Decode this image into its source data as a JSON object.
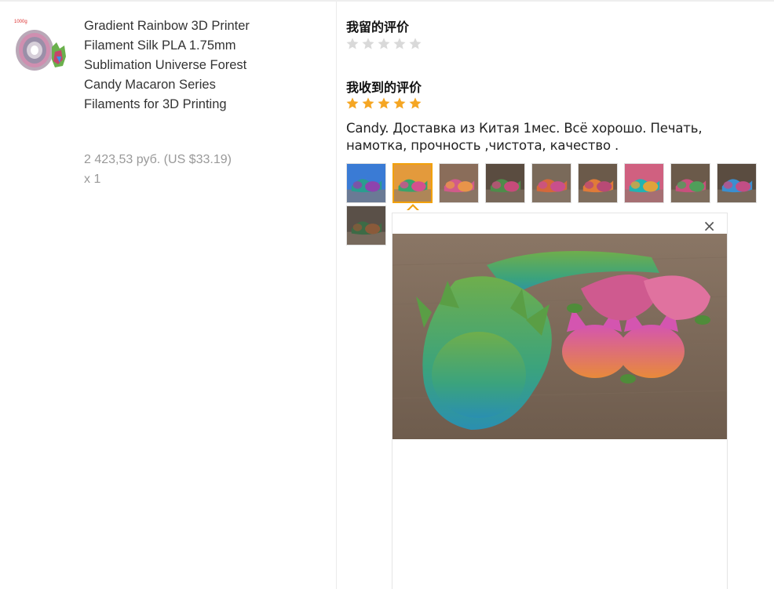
{
  "product": {
    "image_label": "1000g",
    "title": "Gradient Rainbow 3D Printer Filament Silk PLA 1.75mm Sublimation Universe Forest Candy Macaron Series Filaments for 3D Printing",
    "price": "2 423,53 руб. (US $33.19)",
    "quantity": "x 1"
  },
  "my_review": {
    "title": "我留的评价",
    "rating": 0,
    "star_color": "#d9d9d9"
  },
  "received_review": {
    "title": "我收到的评价",
    "rating": 5,
    "star_color": "#f5a623",
    "text": "Candy. Доставка из Китая 1мес. Всё хорошо. Печать, намотка, прочность ,чистота, качество .",
    "photos": [
      {
        "name": "photo-1-axolotl-rainbow",
        "colors": [
          "#2a9d8f",
          "#8e44ad",
          "#3a7bd5"
        ]
      },
      {
        "name": "photo-2-axolotl-green-fox",
        "colors": [
          "#3aa36b",
          "#d4508f",
          "#e39a3c"
        ]
      },
      {
        "name": "photo-3-foxes-pink",
        "colors": [
          "#d05b8a",
          "#e8944a",
          "#8a6d5a"
        ]
      },
      {
        "name": "photo-4-dragon-green",
        "colors": [
          "#4e8c4a",
          "#c64b7a",
          "#5a4c40"
        ]
      },
      {
        "name": "photo-5-dragons-row",
        "colors": [
          "#d4683b",
          "#c94f8c",
          "#7a6a5a"
        ]
      },
      {
        "name": "photo-6-dragons-orange",
        "colors": [
          "#e07b39",
          "#b84a75",
          "#6b5a4a"
        ]
      },
      {
        "name": "photo-7-teal-box",
        "colors": [
          "#22b3b3",
          "#e0a33c",
          "#d06080"
        ]
      },
      {
        "name": "photo-8-dragons-mixed",
        "colors": [
          "#c8507d",
          "#4f9e5a",
          "#6b5a4a"
        ]
      },
      {
        "name": "photo-9-dragon-blue",
        "colors": [
          "#3a8fd0",
          "#c24e85",
          "#5a4c40"
        ]
      },
      {
        "name": "photo-10-dragon-dark",
        "colors": [
          "#3d6b46",
          "#8a5a3a",
          "#5a5048"
        ]
      }
    ],
    "selected_photo_index": 1
  },
  "preview": {
    "close_label": "×"
  }
}
